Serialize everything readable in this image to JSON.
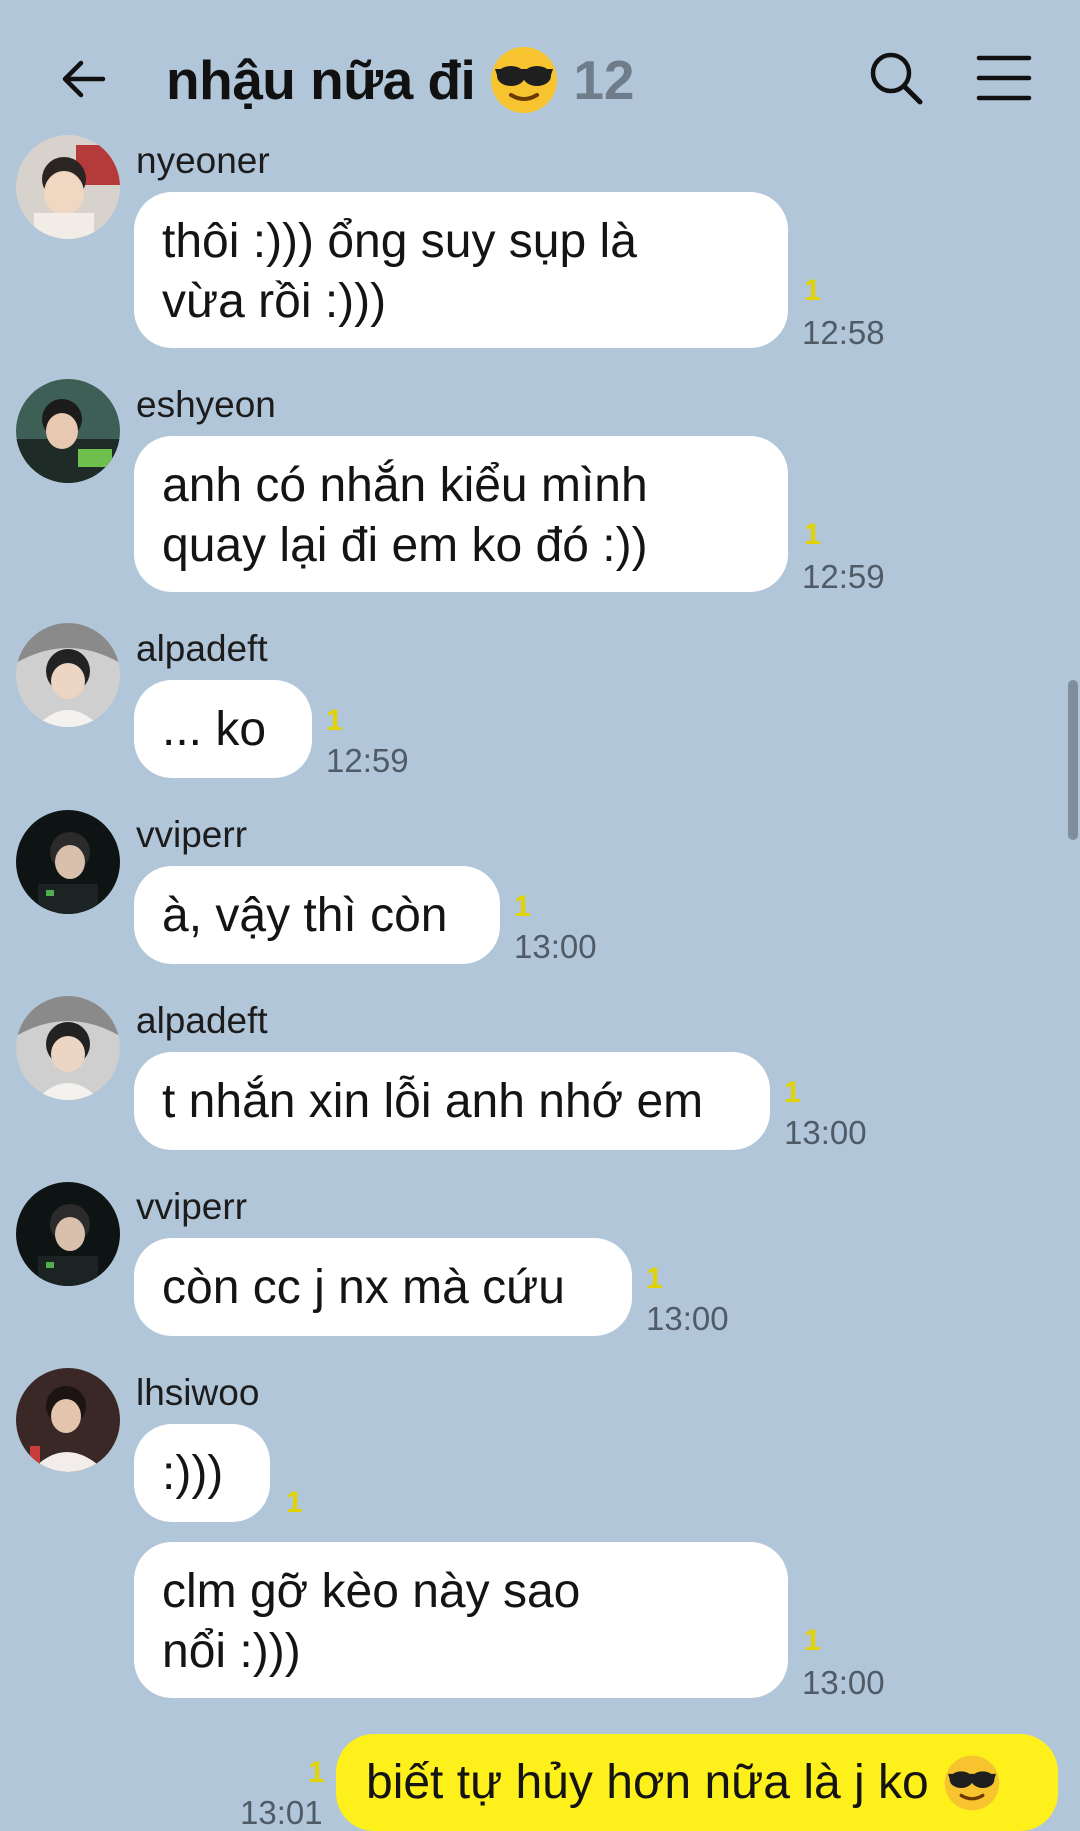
{
  "header": {
    "title": "nhậu nữa đi",
    "member_count": "12"
  },
  "messages": [
    {
      "sender": "nyeoner",
      "text": "thôi :))) ổng suy sụp là\nvừa rồi :)))",
      "unread": "1",
      "time": "12:58"
    },
    {
      "sender": "eshyeon",
      "text": "anh có nhắn kiểu mình\nquay lại đi em ko đó :))",
      "unread": "1",
      "time": "12:59"
    },
    {
      "sender": "alpadeft",
      "text": "... ko",
      "unread": "1",
      "time": "12:59"
    },
    {
      "sender": "vviperr",
      "text": "à, vậy thì còn",
      "unread": "1",
      "time": "13:00"
    },
    {
      "sender": "alpadeft",
      "text": "t nhắn xin lỗi anh nhớ em",
      "unread": "1",
      "time": "13:00"
    },
    {
      "sender": "vviperr",
      "text": "còn cc j nx mà cứu",
      "unread": "1",
      "time": "13:00"
    },
    {
      "sender": "lhsiwoo",
      "text": ":)))",
      "unread": "1",
      "time": ""
    },
    {
      "sender": "",
      "text": "clm gỡ kèo này sao\nnổi :)))",
      "unread": "1",
      "time": "13:00"
    },
    {
      "sender": "me",
      "text": "biết tự hủy hơn nữa là j ko",
      "unread": "1",
      "time": "13:01"
    }
  ],
  "colors": {
    "background": "#b2c6d9",
    "bubble_other": "#ffffff",
    "bubble_mine": "#fef01b",
    "unread": "#e2d200"
  },
  "icons": [
    "back-arrow-icon",
    "sunglasses-emoji-icon",
    "search-icon",
    "menu-icon"
  ]
}
